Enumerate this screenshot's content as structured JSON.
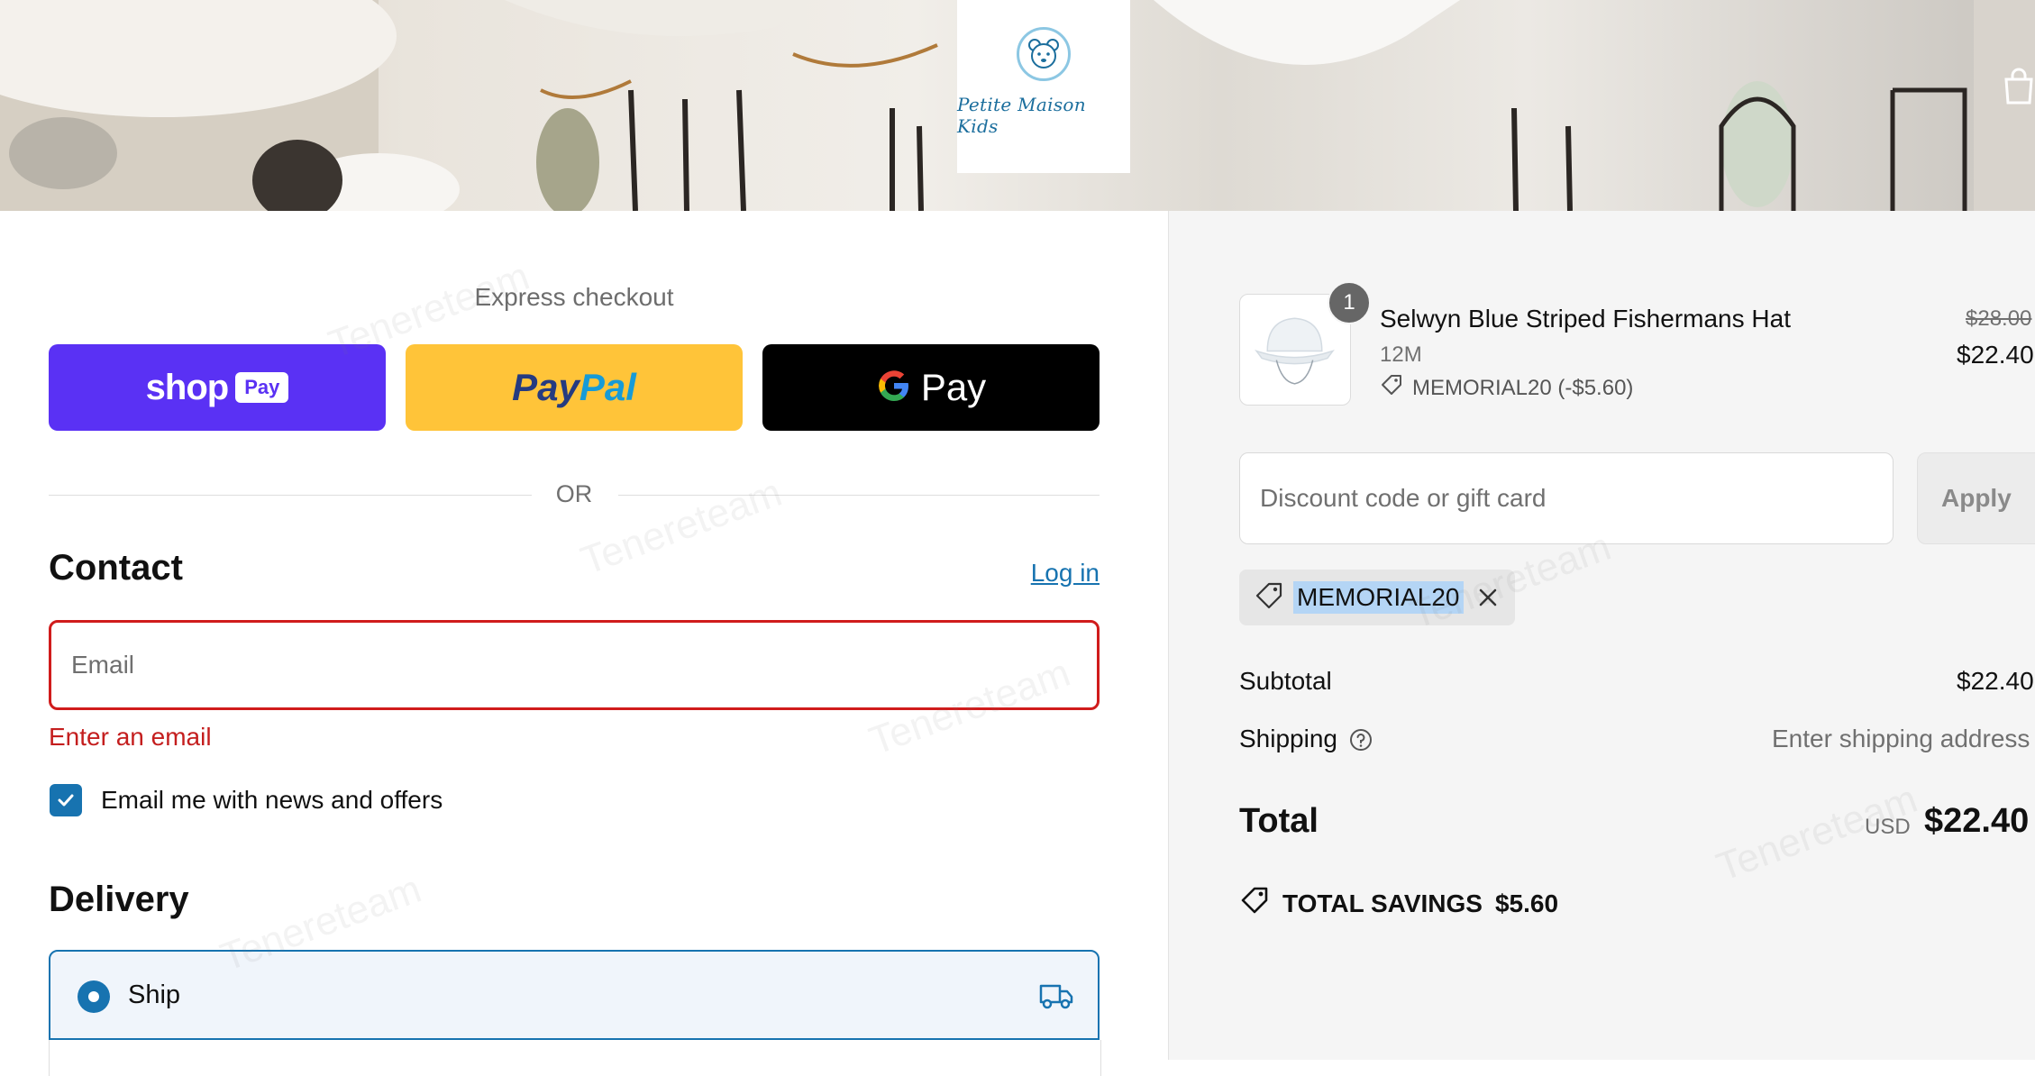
{
  "header": {
    "brand_name": "Petite Maison Kids"
  },
  "express": {
    "label": "Express checkout",
    "shop_pay": {
      "word": "shop",
      "badge": "Pay"
    },
    "paypal": {
      "part1": "Pay",
      "part2": "Pal"
    },
    "gpay": {
      "word": "Pay"
    },
    "or_label": "OR"
  },
  "contact": {
    "title": "Contact",
    "login_link": "Log in",
    "email_placeholder": "Email",
    "email_error": "Enter an email",
    "newsletter_label": "Email me with news and offers",
    "newsletter_checked": true
  },
  "delivery": {
    "title": "Delivery",
    "option_ship": "Ship"
  },
  "summary": {
    "item": {
      "quantity": "1",
      "name": "Selwyn Blue Striped Fishermans Hat",
      "variant": "12M",
      "discount_line": "MEMORIAL20 (-$5.60)",
      "price_original": "$28.00",
      "price_final": "$22.40"
    },
    "discount_placeholder": "Discount code or gift card",
    "apply_label": "Apply",
    "applied_code": "MEMORIAL20",
    "subtotal_label": "Subtotal",
    "subtotal_value": "$22.40",
    "shipping_label": "Shipping",
    "shipping_value": "Enter shipping address",
    "total_label": "Total",
    "currency": "USD",
    "total_value": "$22.40",
    "savings_label": "TOTAL SAVINGS",
    "savings_value": "$5.60"
  },
  "watermark": "Tenereteam",
  "colors": {
    "accent": "#1773b0",
    "error": "#d01c1c",
    "shop_pay": "#5a31f4",
    "paypal": "#ffc439",
    "gpay": "#000000"
  }
}
